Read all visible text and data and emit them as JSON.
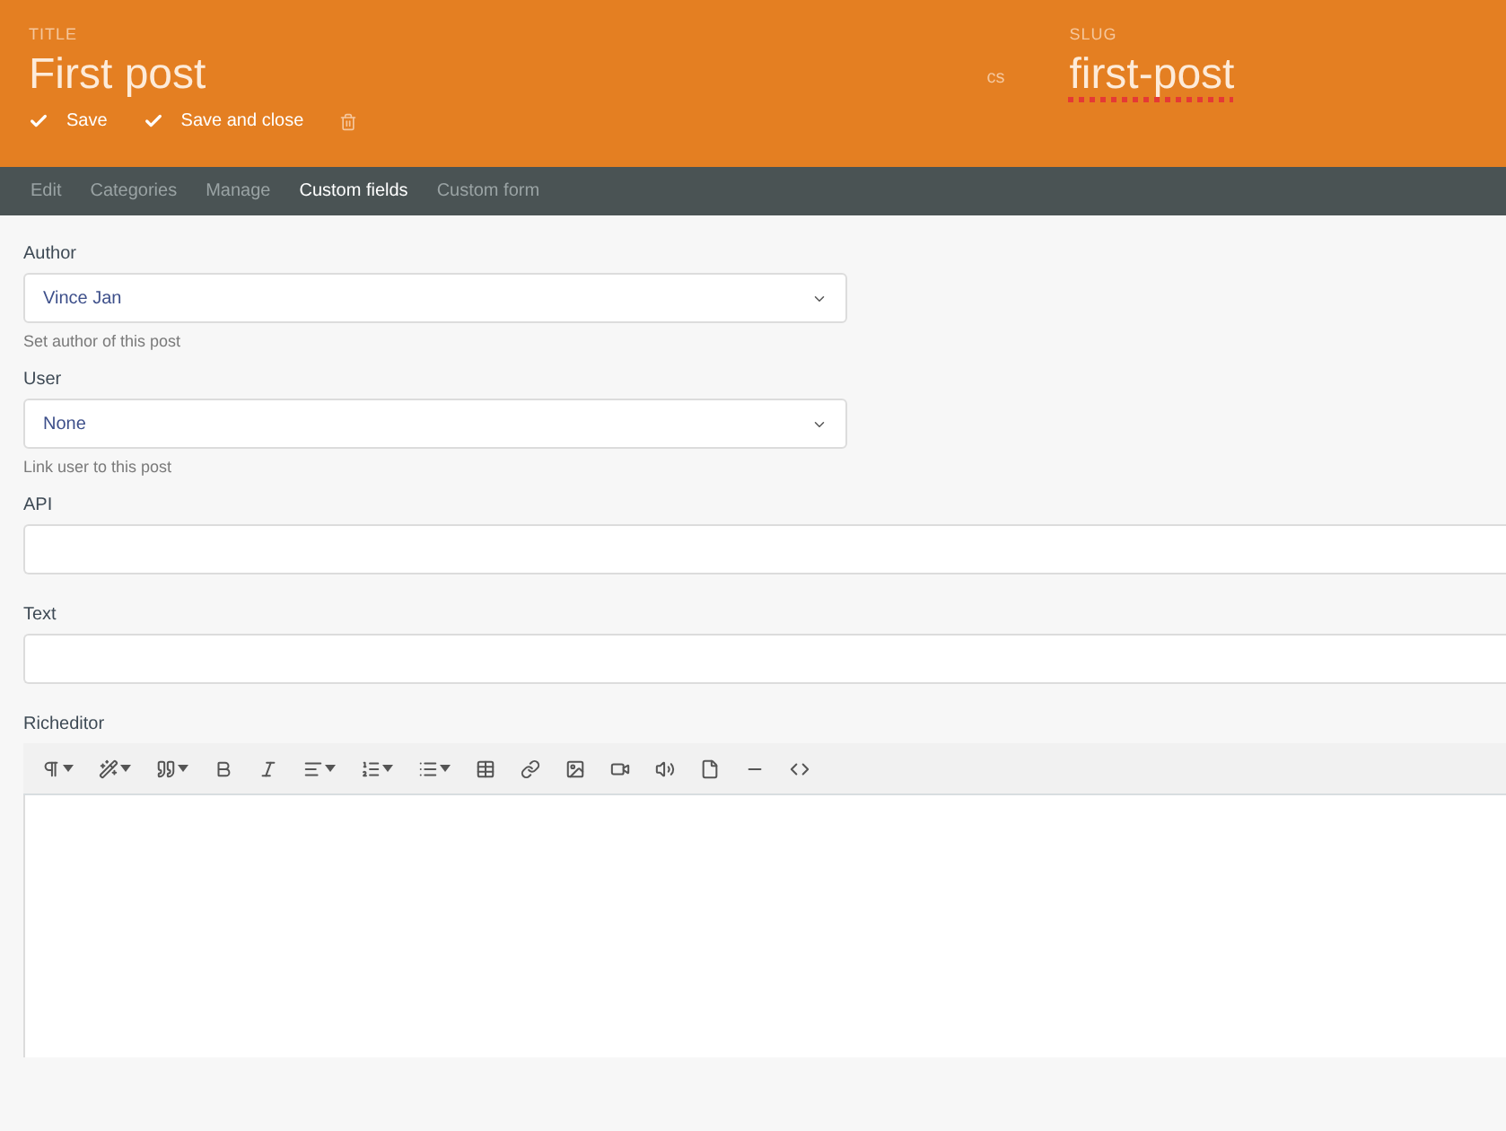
{
  "header": {
    "title_label": "TITLE",
    "title": "First post",
    "language": "cs",
    "slug_label": "SLUG",
    "slug": "first-post",
    "actions": [
      {
        "kind": "confirm",
        "label": "Save"
      },
      {
        "kind": "confirm",
        "label": "Save and close"
      },
      {
        "kind": "delete"
      }
    ]
  },
  "tabs": [
    {
      "label": "Edit",
      "selected": false
    },
    {
      "label": "Categories",
      "selected": false
    },
    {
      "label": "Manage",
      "selected": false
    },
    {
      "label": "Custom fields",
      "selected": true
    },
    {
      "label": "Custom form",
      "selected": false
    }
  ],
  "fields": [
    {
      "kind": "select",
      "label": "Author",
      "value": "Vince Jan",
      "help": "Set author of this post"
    },
    {
      "kind": "select",
      "label": "User",
      "value": "None",
      "help": "Link user to this post"
    },
    {
      "kind": "text",
      "label": "API"
    },
    {
      "kind": "text",
      "label": "Text"
    },
    {
      "kind": "richeditor",
      "label": "Richeditor",
      "toolbar": [
        {
          "kind": "paragraph",
          "dropdown": true
        },
        {
          "kind": "style",
          "dropdown": true
        },
        {
          "kind": "quote",
          "dropdown": true
        },
        {
          "kind": "bold",
          "dropdown": false
        },
        {
          "kind": "italic",
          "dropdown": false
        },
        {
          "kind": "align",
          "dropdown": true
        },
        {
          "kind": "ordered-list",
          "dropdown": true
        },
        {
          "kind": "bullet-list",
          "dropdown": true
        },
        {
          "kind": "table",
          "dropdown": false
        },
        {
          "kind": "link",
          "dropdown": false
        },
        {
          "kind": "image",
          "dropdown": false
        },
        {
          "kind": "video",
          "dropdown": false
        },
        {
          "kind": "audio",
          "dropdown": false
        },
        {
          "kind": "file",
          "dropdown": false
        },
        {
          "kind": "rule",
          "dropdown": false
        },
        {
          "kind": "code",
          "dropdown": false
        }
      ]
    }
  ]
}
